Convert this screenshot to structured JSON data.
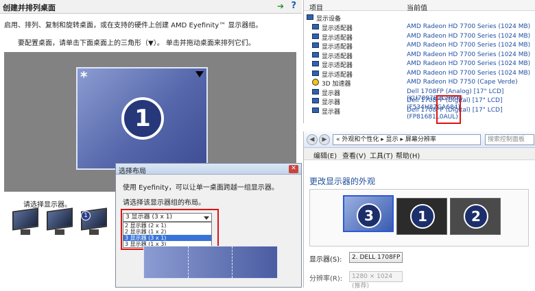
{
  "left": {
    "title": "创建并排列桌面",
    "desc1": "启用、排列、复制和旋转桌面，或在支持的硬件上创建 AMD Eyefinity™ 显示器组。",
    "desc2": "要配置桌面，请单击下面桌面上的三角形（▼）。 单击并拖动桌面来排列它们。",
    "desktop_number": "1",
    "select_label": "请选择显示器。",
    "thumb_badge": "1"
  },
  "dialog": {
    "title": "选择布局",
    "line1": "使用 Eyefinity，可以让单一桌面跨越一组显示器。",
    "line2": "请选择该显示器组的布局。",
    "combo_value": "3 显示器 (3 x 1)",
    "options": [
      "2 显示器 (2 x 1)",
      "2 显示器 (1 x 2)",
      "3 显示器 (3 x 1)",
      "3 显示器 (1 x 3)"
    ]
  },
  "devices": {
    "col_item": "项目",
    "col_value": "当前值",
    "group": "显示设备",
    "rows": [
      {
        "name": "显示适配器",
        "value": "AMD Radeon HD 7700 Series  (1024 MB)"
      },
      {
        "name": "显示适配器",
        "value": "AMD Radeon HD 7700 Series  (1024 MB)"
      },
      {
        "name": "显示适配器",
        "value": "AMD Radeon HD 7700 Series  (1024 MB)"
      },
      {
        "name": "显示适配器",
        "value": "AMD Radeon HD 7700 Series  (1024 MB)"
      },
      {
        "name": "显示适配器",
        "value": "AMD Radeon HD 7700 Series  (1024 MB)"
      },
      {
        "name": "显示适配器",
        "value": "AMD Radeon HD 7700 Series  (1024 MB)"
      },
      {
        "name": "3D 加速器",
        "value": "AMD Radeon HD 7750 (Cape Verde)"
      },
      {
        "name": "显示器",
        "value": "Dell 1708FP (Analog) [17\" LCD]  (KU7897B2GHMK)"
      },
      {
        "name": "显示器",
        "value": "Dell 1708FP (Digital) [17\" LCD]  (F534H87GA684)"
      },
      {
        "name": "显示器",
        "value": "Dell 1708FP (Digital) [17\" LCD]  (FP81681L0AUL)"
      }
    ]
  },
  "display": {
    "breadcrumb": "«  外观和个性化  ▸  显示  ▸  屏幕分辨率",
    "search_placeholder": "搜索控制面板",
    "menu": [
      "编辑(E)",
      "查看(V)",
      "工具(T)",
      "帮助(H)"
    ],
    "heading": "更改显示器的外观",
    "monitors": [
      "3",
      "1",
      "2"
    ],
    "display_label": "显示器(S):",
    "display_value": "2. DELL 1708FP",
    "resolution_label": "分辨率(R):",
    "resolution_value": "1280 × 1024 (推荐)"
  }
}
